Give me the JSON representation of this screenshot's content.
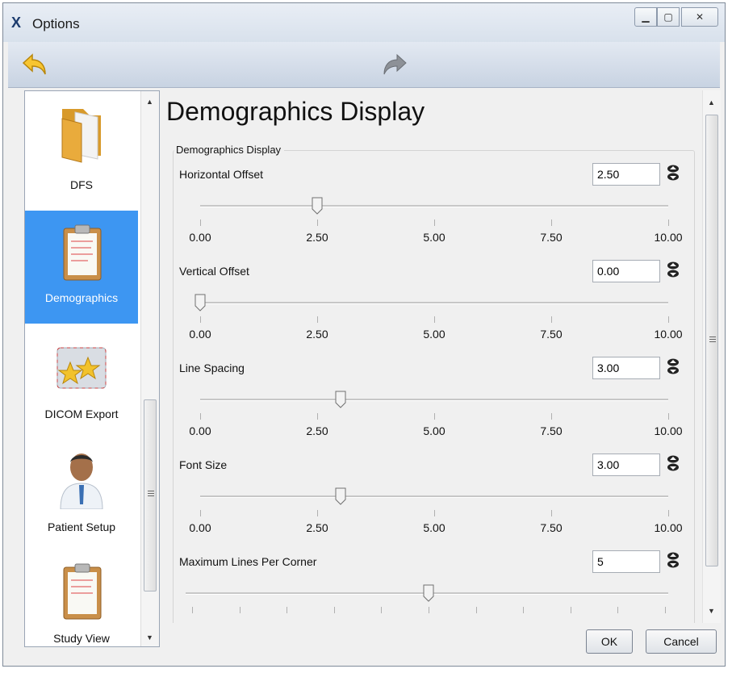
{
  "window": {
    "title": "Options"
  },
  "page": {
    "title": "Demographics Display"
  },
  "group": {
    "title": "Demographics Display"
  },
  "sidebar": {
    "items": [
      {
        "label": "DFS",
        "icon": "folder-icon",
        "selected": false
      },
      {
        "label": "Demographics",
        "icon": "clipboard-icon",
        "selected": true
      },
      {
        "label": "DICOM Export",
        "icon": "stars-envelope-icon",
        "selected": false
      },
      {
        "label": "Patient Setup",
        "icon": "person-icon",
        "selected": false
      },
      {
        "label": "Study View",
        "icon": "clipboard-icon",
        "selected": false
      }
    ]
  },
  "settings": [
    {
      "label": "Horizontal Offset",
      "value": "2.50",
      "slider_value": 2.5,
      "ticks": [
        "0.00",
        "2.50",
        "5.00",
        "7.50",
        "10.00"
      ],
      "min": 0,
      "max": 10
    },
    {
      "label": "Vertical Offset",
      "value": "0.00",
      "slider_value": 0.0,
      "ticks": [
        "0.00",
        "2.50",
        "5.00",
        "7.50",
        "10.00"
      ],
      "min": 0,
      "max": 10
    },
    {
      "label": "Line Spacing",
      "value": "3.00",
      "slider_value": 3.0,
      "ticks": [
        "0.00",
        "2.50",
        "5.00",
        "7.50",
        "10.00"
      ],
      "min": 0,
      "max": 10
    },
    {
      "label": "Font Size",
      "value": "3.00",
      "slider_value": 3.0,
      "ticks": [
        "0.00",
        "2.50",
        "5.00",
        "7.50",
        "10.00"
      ],
      "min": 0,
      "max": 10
    },
    {
      "label": "Maximum Lines Per Corner",
      "value": "5",
      "slider_value": 5,
      "ticks": [],
      "min": 0,
      "max": 10
    }
  ],
  "buttons": {
    "ok": "OK",
    "cancel": "Cancel"
  },
  "colors": {
    "selected_bg": "#3d96f2",
    "toolbar": "#d3dceb"
  }
}
